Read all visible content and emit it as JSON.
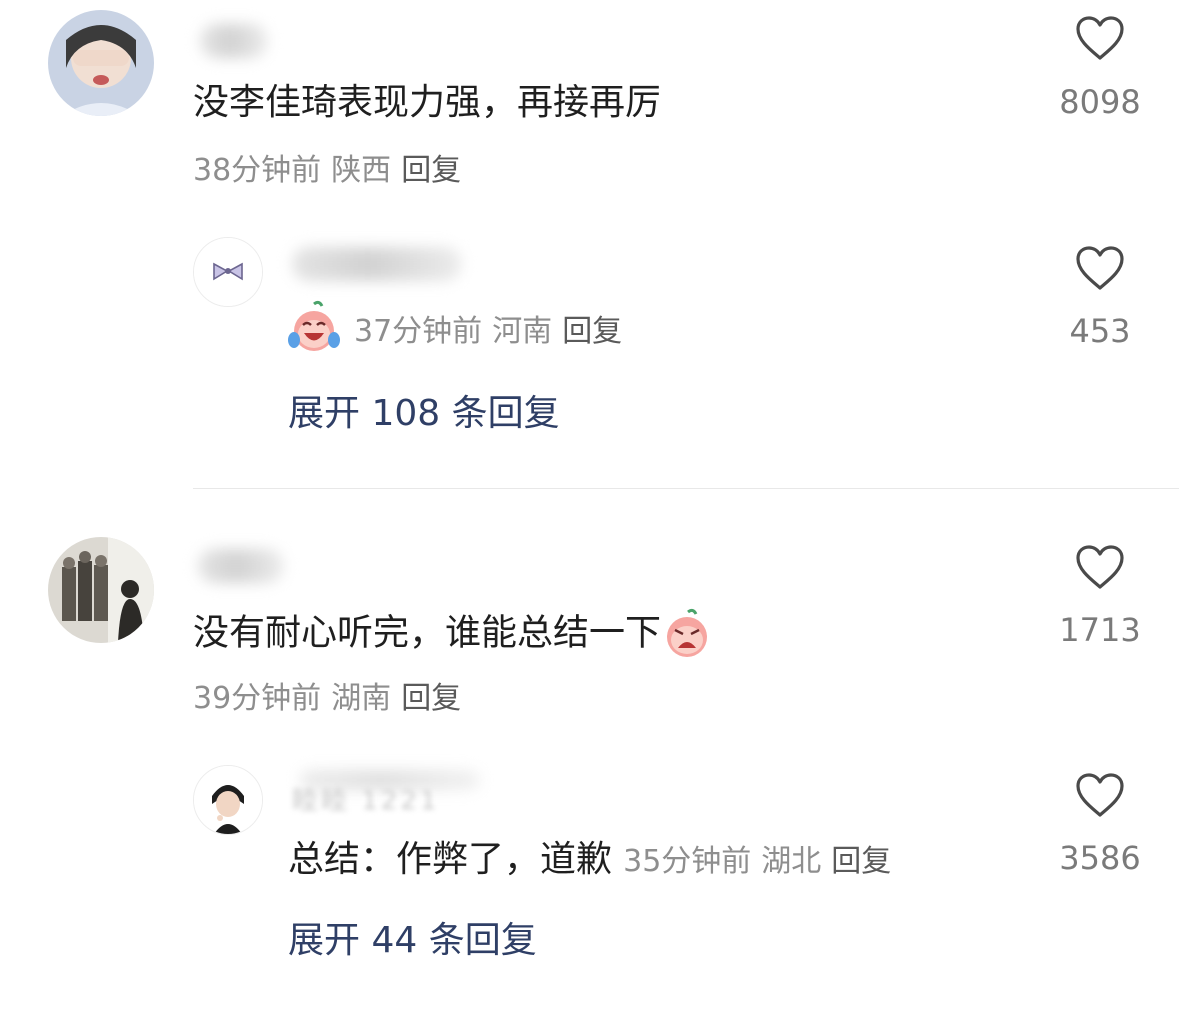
{
  "comments": [
    {
      "text": "没李佳琦表现力强，再接再厉",
      "time": "38分钟前",
      "location": "陕西",
      "reply_label": "回复",
      "likes": "8098",
      "reply": {
        "username_fragment": "",
        "time": "37分钟前",
        "location": "河南",
        "reply_label": "回复",
        "likes": "453",
        "emoji": "crying-laughing-peach-emoji"
      },
      "expand_label": "展开 108 条回复"
    },
    {
      "text": "没有耐心听完，谁能总结一下",
      "emoji": "crying-peach-emoji",
      "time": "39分钟前",
      "location": "湖南",
      "reply_label": "回复",
      "likes": "1713",
      "reply": {
        "username_fragment": "睦睦 1221",
        "text": "总结：作弊了，道歉",
        "time": "35分钟前",
        "location": "湖北",
        "reply_label": "回复",
        "likes": "3586"
      },
      "expand_label": "展开 44 条回复"
    }
  ],
  "icons": {
    "like": "heart-outline-icon"
  },
  "colors": {
    "text": "#1f1f1f",
    "meta": "#8e8e8e",
    "expand_link": "#2f3f66",
    "divider": "#e8e8e8"
  }
}
